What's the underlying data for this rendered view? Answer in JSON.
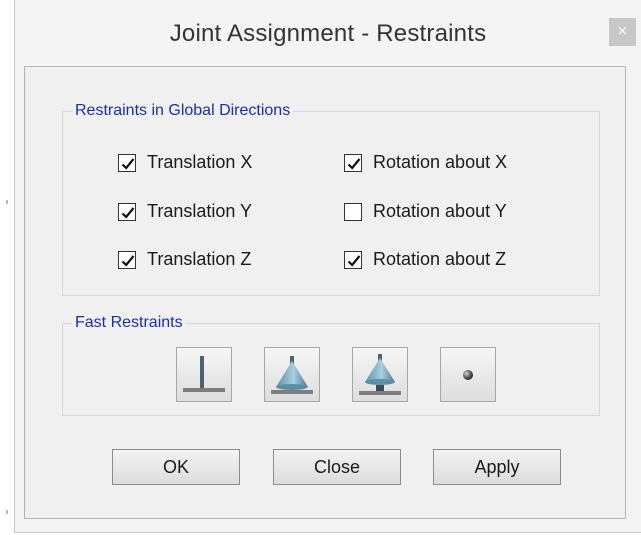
{
  "window": {
    "title": "Joint Assignment - Restraints",
    "close_glyph": "×"
  },
  "restraints_group": {
    "legend": "Restraints in Global Directions",
    "items": [
      {
        "label": "Translation  X",
        "checked": true
      },
      {
        "label": "Translation  Y",
        "checked": true
      },
      {
        "label": "Translation  Z",
        "checked": true
      },
      {
        "label": "Rotation about  X",
        "checked": true
      },
      {
        "label": "Rotation about  Y",
        "checked": false
      },
      {
        "label": "Rotation about  Z",
        "checked": true
      }
    ]
  },
  "fast_restraints_group": {
    "legend": "Fast Restraints",
    "buttons": [
      {
        "icon": "fixed-support-icon"
      },
      {
        "icon": "pinned-support-icon"
      },
      {
        "icon": "roller-support-icon"
      },
      {
        "icon": "free-joint-icon"
      }
    ]
  },
  "buttons": {
    "ok": "OK",
    "close": "Close",
    "apply": "Apply"
  },
  "colors": {
    "legend_text": "#1a2ea8",
    "dialog_bg": "#f0f0f0",
    "close_button_bg": "#c7c7c7"
  }
}
